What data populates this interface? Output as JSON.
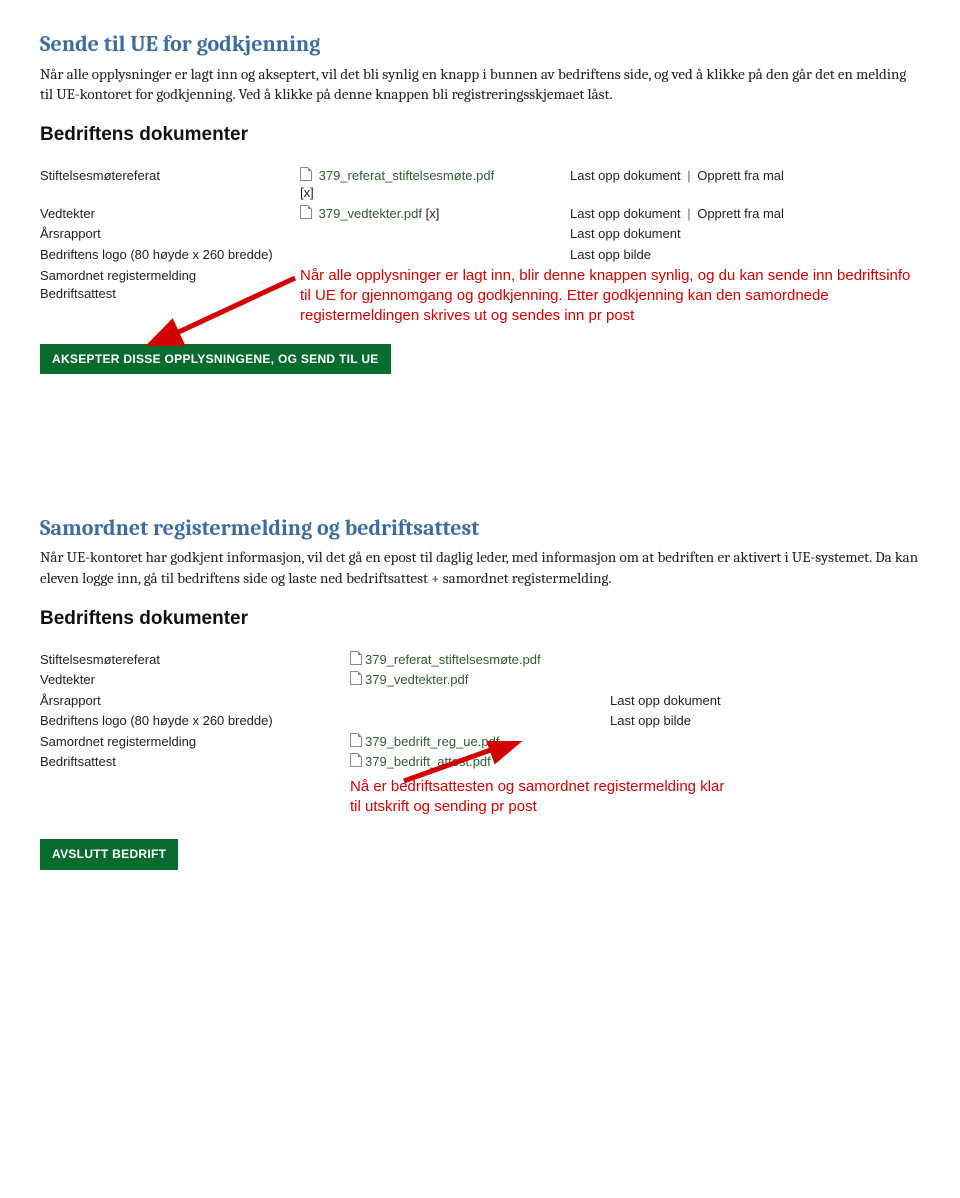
{
  "section1": {
    "heading": "Sende til UE for godkjenning",
    "body": "Når alle opplysninger er lagt inn og akseptert, vil det bli synlig en knapp i bunnen av bedriftens side, og ved å klikke på den går det en melding til UE-kontoret for godkjenning. Ved å klikke på denne knappen bli registreringsskjemaet låst."
  },
  "shot1": {
    "title": "Bedriftens dokumenter",
    "rows": [
      {
        "label": "Stiftelsesmøtereferat",
        "file": "379_referat_stiftelsesmøte.pdf",
        "x": "[x]",
        "actions": [
          "Last opp dokument",
          "Opprett fra mal"
        ]
      },
      {
        "label": "Vedtekter",
        "file": "379_vedtekter.pdf",
        "xInline": " [x]",
        "actions": [
          "Last opp dokument",
          "Opprett fra mal"
        ]
      },
      {
        "label": "Årsrapport",
        "file": "",
        "actions": [
          "Last opp dokument"
        ]
      },
      {
        "label": "Bedriftens logo (80 høyde x 260 bredde)",
        "file": "",
        "actions": [
          "Last opp bilde"
        ]
      },
      {
        "label": "Samordnet registermelding",
        "file": "",
        "actions": []
      },
      {
        "label": "Bedriftsattest",
        "file": "",
        "actions": []
      }
    ],
    "annotation": "Når alle opplysninger er lagt inn, blir denne knappen synlig, og du kan sende inn bedriftsinfo til UE for gjennomgang og godkjenning. Etter godkjenning kan den samordnede registermeldingen skrives ut og sendes inn pr post",
    "button": "AKSEPTER DISSE OPPLYSNINGENE, OG SEND TIL UE"
  },
  "section2": {
    "heading": "Samordnet registermelding og bedriftsattest",
    "body": "Når UE-kontoret har godkjent informasjon, vil det gå en epost til daglig leder, med informasjon om at bedriften er aktivert i UE-systemet. Da kan eleven logge inn, gå til bedriftens side og laste ned bedriftsattest + samordnet registermelding."
  },
  "shot2": {
    "title": "Bedriftens dokumenter",
    "rows": [
      {
        "label": "Stiftelsesmøtereferat",
        "file": "379_referat_stiftelsesmøte.pdf",
        "actions": []
      },
      {
        "label": "Vedtekter",
        "file": "379_vedtekter.pdf",
        "actions": []
      },
      {
        "label": "Årsrapport",
        "file": "",
        "actions": [
          "Last opp dokument"
        ]
      },
      {
        "label": "Bedriftens logo (80 høyde x 260 bredde)",
        "file": "",
        "actions": [
          "Last opp bilde"
        ]
      },
      {
        "label": "Samordnet registermelding",
        "file": "379_bedrift_reg_ue.pdf",
        "actions": []
      },
      {
        "label": "Bedriftsattest",
        "file": "379_bedrift_attest.pdf",
        "actions": []
      }
    ],
    "annotation": "Nå er bedriftsattesten og samordnet registermelding klar til utskrift og sending pr post",
    "button": "AVSLUTT BEDRIFT"
  }
}
